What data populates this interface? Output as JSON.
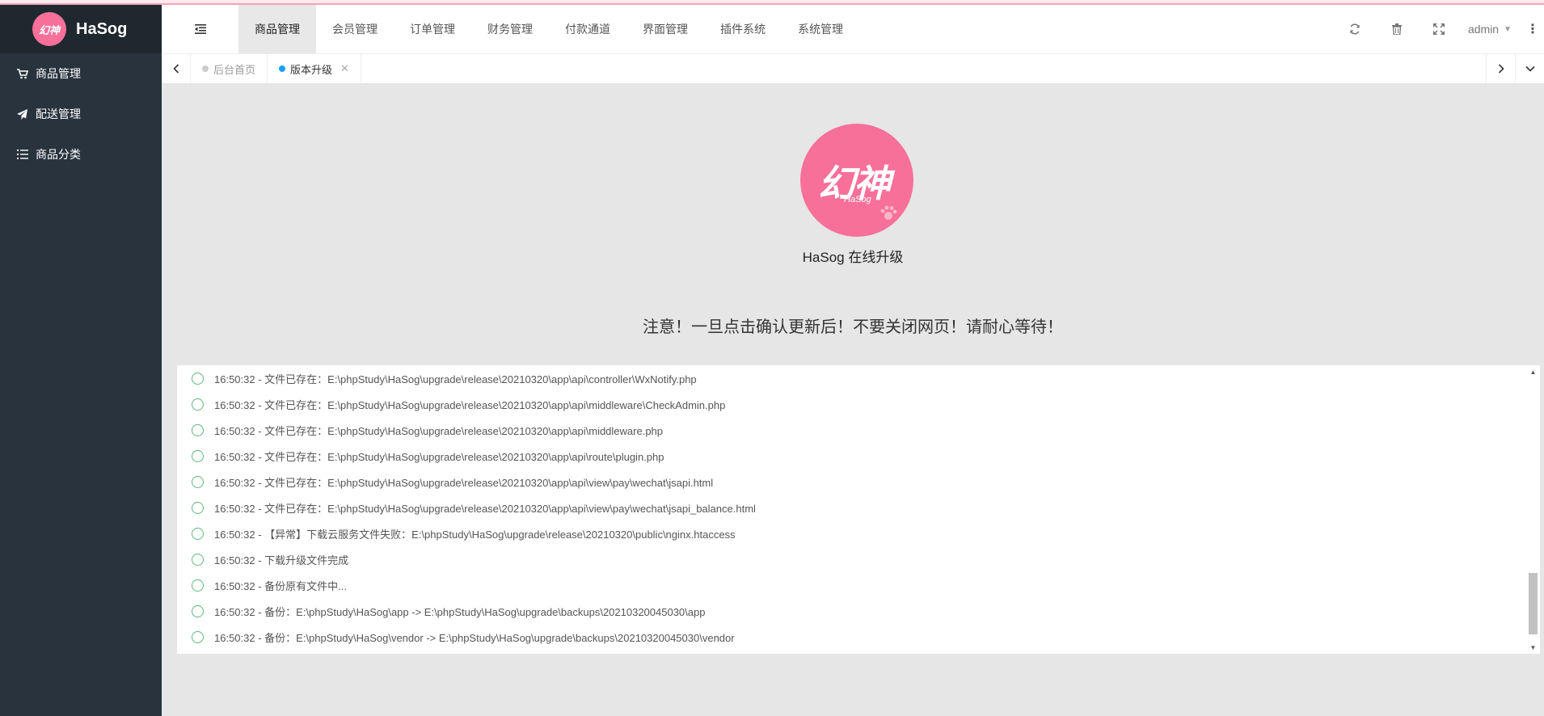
{
  "brand": {
    "logo_text": "幻神",
    "name": "HaSog"
  },
  "sidebar": {
    "items": [
      {
        "label": "商品管理",
        "icon": "cart-icon"
      },
      {
        "label": "配送管理",
        "icon": "paper-plane-icon"
      },
      {
        "label": "商品分类",
        "icon": "list-icon"
      }
    ]
  },
  "header": {
    "nav": [
      "商品管理",
      "会员管理",
      "订单管理",
      "财务管理",
      "付款通道",
      "界面管理",
      "插件系统",
      "系统管理"
    ],
    "active_index": 0,
    "user": "admin"
  },
  "tabs": {
    "items": [
      {
        "label": "后台首页",
        "active": false
      },
      {
        "label": "版本升级",
        "active": true
      }
    ]
  },
  "main": {
    "logo_text": "幻神",
    "logo_subtext": "HaSog",
    "title": "HaSog 在线升级",
    "notice": "注意！一旦点击确认更新后！不要关闭网页！请耐心等待！"
  },
  "log": [
    "16:50:32 - 文件已存在：E:\\phpStudy\\HaSog\\upgrade\\release\\20210320\\app\\api\\controller\\WxNotify.php",
    "16:50:32 - 文件已存在：E:\\phpStudy\\HaSog\\upgrade\\release\\20210320\\app\\api\\middleware\\CheckAdmin.php",
    "16:50:32 - 文件已存在：E:\\phpStudy\\HaSog\\upgrade\\release\\20210320\\app\\api\\middleware.php",
    "16:50:32 - 文件已存在：E:\\phpStudy\\HaSog\\upgrade\\release\\20210320\\app\\api\\route\\plugin.php",
    "16:50:32 - 文件已存在：E:\\phpStudy\\HaSog\\upgrade\\release\\20210320\\app\\api\\view\\pay\\wechat\\jsapi.html",
    "16:50:32 - 文件已存在：E:\\phpStudy\\HaSog\\upgrade\\release\\20210320\\app\\api\\view\\pay\\wechat\\jsapi_balance.html",
    "16:50:32 - 【异常】下载云服务文件失败：E:\\phpStudy\\HaSog\\upgrade\\release\\20210320\\public\\nginx.htaccess",
    "16:50:32 - 下载升级文件完成",
    "16:50:32 - 备份原有文件中...",
    "16:50:32 - 备份：E:\\phpStudy\\HaSog\\app -> E:\\phpStudy\\HaSog\\upgrade\\backups\\20210320045030\\app",
    "16:50:32 - 备份：E:\\phpStudy\\HaSog\\vendor -> E:\\phpStudy\\HaSog\\upgrade\\backups\\20210320045030\\vendor"
  ],
  "colors": {
    "sidebar_bg": "#28333e",
    "brand_bg": "#20282f",
    "logo_pink": "#f7709a",
    "log_circle": "#5fb878",
    "active_tab_dot": "#1e9fff"
  }
}
